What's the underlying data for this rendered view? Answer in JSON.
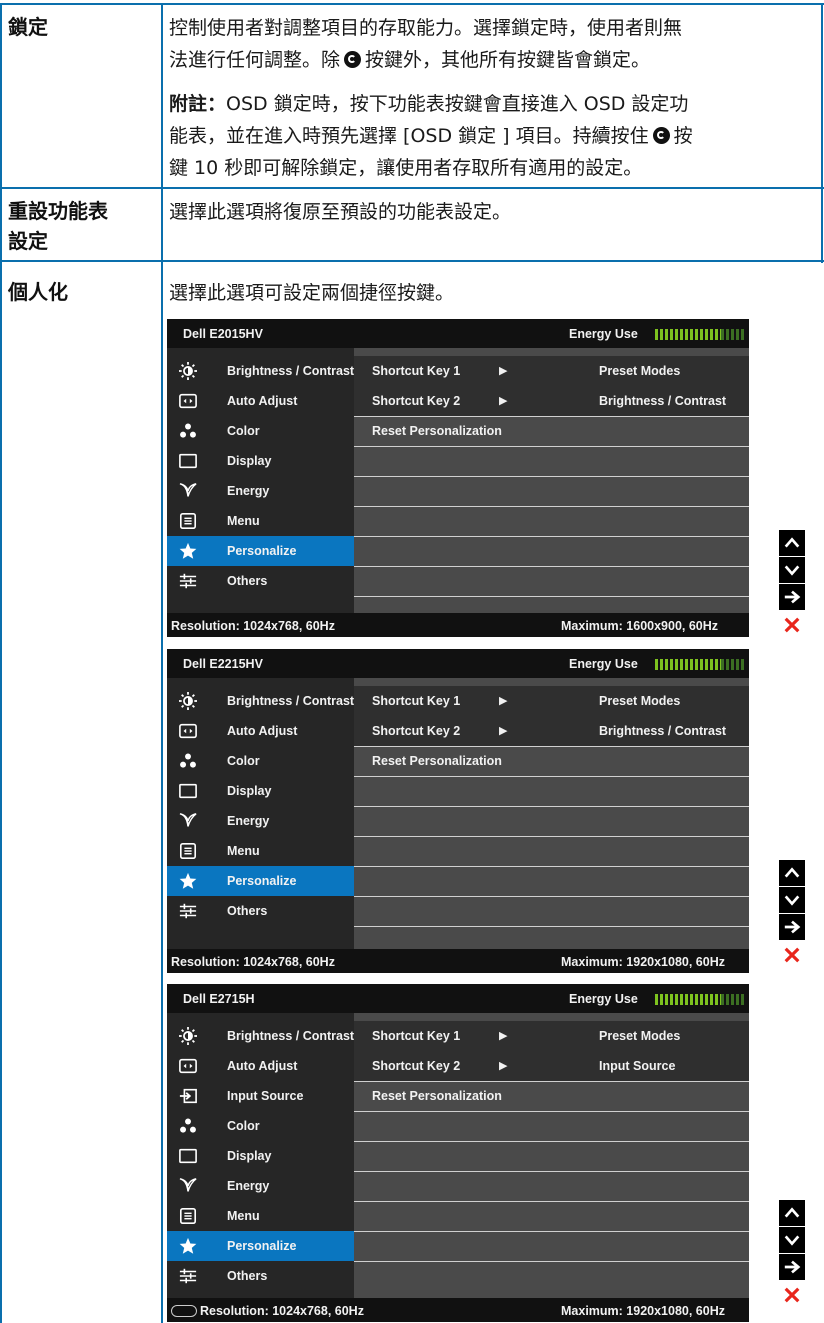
{
  "rows": {
    "lock": {
      "title": "鎖定",
      "desc_1a": "控制使用者對調整項目的存取能力。選擇鎖定時，使用者則無",
      "desc_1b_pre": "法進行任何調整。除",
      "desc_1b_post": "按鍵外，其他所有按鍵皆會鎖定。",
      "note_label": "附註：",
      "note_a": "OSD 鎖定時，按下功能表按鍵會直接進入 OSD 設定功",
      "note_b_pre": "能表，並在進入時預先選擇 [OSD 鎖定 ] 項目。持續按住",
      "note_b_post": "按",
      "note_c": "鍵 10 秒即可解除鎖定，讓使用者存取所有適用的設定。"
    },
    "reset": {
      "title_a": "重設功能表",
      "title_b": "設定",
      "desc": "選擇此選項將復原至預設的功能表設定。"
    },
    "personalize": {
      "title": "個人化",
      "desc": "選擇此選項可設定兩個捷徑按鍵。"
    }
  },
  "osd_common": {
    "energy_label": "Energy Use",
    "side_items": {
      "brightness": "Brightness / Contrast",
      "auto_adjust": "Auto Adjust",
      "input_source": "Input Source",
      "color": "Color",
      "display": "Display",
      "energy": "Energy",
      "menu": "Menu",
      "personalize": "Personalize",
      "others": "Others"
    },
    "shortcut_key_1": "Shortcut Key 1",
    "shortcut_key_2": "Shortcut Key 2",
    "reset_personalization": "Reset Personalization",
    "arrow": "▶"
  },
  "osd": [
    {
      "model": "Dell E2015HV",
      "key1_value": "Preset Modes",
      "key2_value": "Brightness / Contrast",
      "resolution": "Resolution: 1024x768, 60Hz",
      "maximum": "Maximum: 1600x900, 60Hz"
    },
    {
      "model": "Dell E2215HV",
      "key1_value": "Preset Modes",
      "key2_value": "Brightness / Contrast",
      "resolution": "Resolution: 1024x768, 60Hz",
      "maximum": "Maximum: 1920x1080, 60Hz"
    },
    {
      "model": "Dell E2715H",
      "key1_value": "Preset Modes",
      "key2_value": "Input Source",
      "resolution": "Resolution: 1024x768,  60Hz",
      "maximum": "Maximum: 1920x1080,  60Hz"
    }
  ],
  "colors": {
    "accent": "#0a76c0",
    "energy_green": "#7ec31f",
    "close_red": "#e8261c",
    "rule_blue": "#0a6fad"
  },
  "icons": [
    "brightness-icon",
    "auto-adjust-icon",
    "input-source-icon",
    "color-icon",
    "display-icon",
    "energy-icon",
    "menu-icon",
    "star-icon",
    "others-icon",
    "up-arrow-icon",
    "down-arrow-icon",
    "right-arrow-icon",
    "close-icon",
    "return-button-icon"
  ]
}
